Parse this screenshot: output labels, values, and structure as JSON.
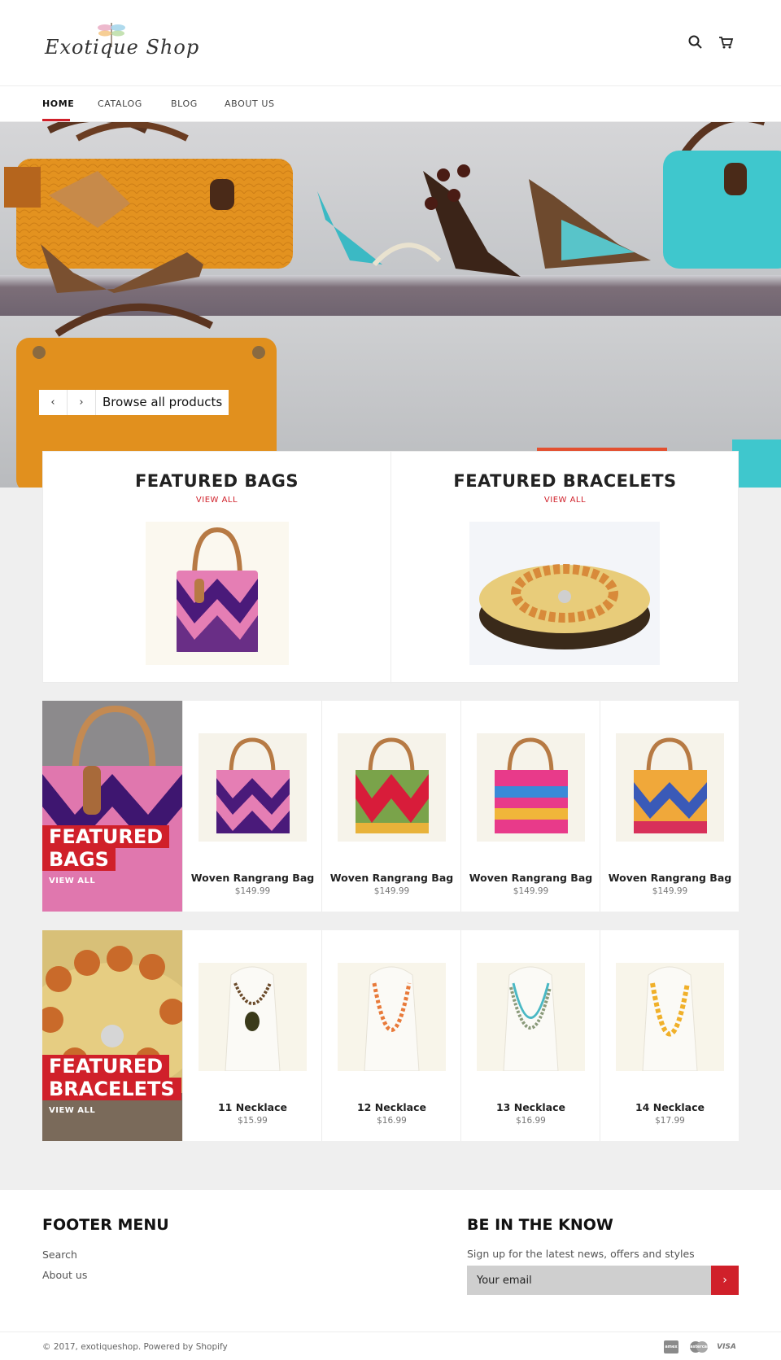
{
  "header": {
    "logo_text": "Exotique Shop",
    "search_icon": "search-icon",
    "cart_icon": "cart-icon"
  },
  "nav": {
    "items": [
      {
        "label": "HOME",
        "active": true
      },
      {
        "label": "CATALOG",
        "active": false
      },
      {
        "label": "BLOG",
        "active": false
      },
      {
        "label": "ABOUT US",
        "active": false
      }
    ]
  },
  "hero": {
    "prev_icon": "chevron-left-icon",
    "next_icon": "chevron-right-icon",
    "prev_label": "‹",
    "next_label": "›",
    "link_label": "Browse all products"
  },
  "featured_collections": [
    {
      "title": "FEATURED BAGS",
      "view_all": "VIEW ALL"
    },
    {
      "title": "FEATURED BRACELETS",
      "view_all": "VIEW ALL"
    }
  ],
  "bags_row": {
    "tag_line1": "FEATURED",
    "tag_line2": "BAGS",
    "view_all": "VIEW ALL",
    "products": [
      {
        "name": "Woven Rangrang Bag",
        "price": "$149.99"
      },
      {
        "name": "Woven Rangrang Bag",
        "price": "$149.99"
      },
      {
        "name": "Woven Rangrang Bag",
        "price": "$149.99"
      },
      {
        "name": "Woven Rangrang Bag",
        "price": "$149.99"
      }
    ]
  },
  "bracelets_row": {
    "tag_line1": "FEATURED",
    "tag_line2": "BRACELETS",
    "view_all": "VIEW ALL",
    "products": [
      {
        "name": "11 Necklace",
        "price": "$15.99"
      },
      {
        "name": "12 Necklace",
        "price": "$16.99"
      },
      {
        "name": "13 Necklace",
        "price": "$16.99"
      },
      {
        "name": "14 Necklace",
        "price": "$17.99"
      }
    ]
  },
  "footer": {
    "menu_title": "FOOTER MENU",
    "menu_links": [
      "Search",
      "About us"
    ],
    "newsletter_title": "BE IN THE KNOW",
    "newsletter_sub": "Sign up for the latest news, offers and styles",
    "email_placeholder": "Your email",
    "submit_label": "›",
    "copyright": "© 2017, exotiqueshop. Powered by Shopify",
    "payment_icons": [
      "amex",
      "mastercard",
      "VISA"
    ]
  },
  "colors": {
    "accent": "#d0202a",
    "body_bg": "#efefef"
  }
}
